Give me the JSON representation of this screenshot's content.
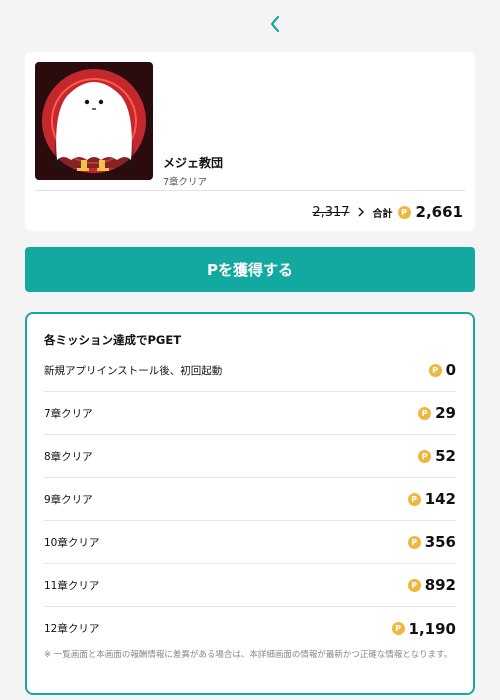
{
  "header": {
    "back_icon": "chevron-left-icon",
    "accent_color": "#13a9a0"
  },
  "app": {
    "name": "メジェ教団",
    "subtitle": "7章クリア",
    "old_points": "2,317",
    "total_label": "合計",
    "total_points": "2,661"
  },
  "coin_symbol": "P",
  "get_button": {
    "label": "Pを獲得する"
  },
  "missions": {
    "title": "各ミッション達成でPGET",
    "items": [
      {
        "label": "新規アプリインストール後、初回起動",
        "points": "0"
      },
      {
        "label": "7章クリア",
        "points": "29"
      },
      {
        "label": "8章クリア",
        "points": "52"
      },
      {
        "label": "9章クリア",
        "points": "142"
      },
      {
        "label": "10章クリア",
        "points": "356"
      },
      {
        "label": "11章クリア",
        "points": "892"
      },
      {
        "label": "12章クリア",
        "points": "1,190"
      }
    ],
    "note": "※ 一覧画面と本画面の報酬情報に差異がある場合は、本詳細画面の情報が最新かつ正確な情報となります。"
  }
}
